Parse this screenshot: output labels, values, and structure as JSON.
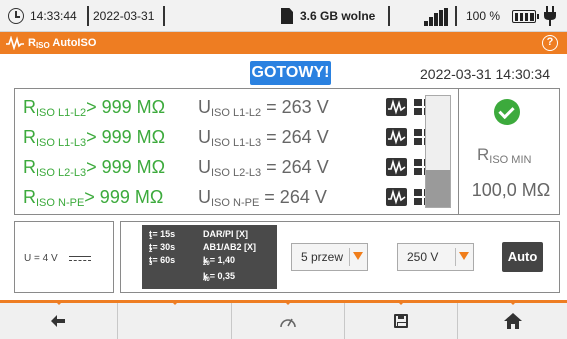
{
  "status_bar": {
    "time": "14:33:44",
    "date": "2022-03-31",
    "storage": "3.6 GB wolne",
    "battery_percent": "100 %",
    "battery_level": 1.0,
    "icons": [
      "clock-icon",
      "sd-card-icon",
      "signal-icon",
      "battery-icon",
      "plug-icon"
    ]
  },
  "title_bar": {
    "title_main": "R",
    "title_sub": "ISO",
    "title_rest": " AutoISO",
    "help_label": "?",
    "icons": [
      "waveform-icon",
      "help-icon"
    ]
  },
  "status": {
    "badge": "GOTOWY!",
    "datetime": "2022-03-31 14:30:34"
  },
  "results": [
    {
      "r_main": "R",
      "r_sub": "ISO L1-L2",
      "r_value": "> 999 MΩ",
      "u_main": "U",
      "u_sub": "ISO L1-L2",
      "u_value": " = 263 V"
    },
    {
      "r_main": "R",
      "r_sub": "ISO L1-L3",
      "r_value": "> 999 MΩ",
      "u_main": "U",
      "u_sub": "ISO L1-L3",
      "u_value": " = 264 V"
    },
    {
      "r_main": "R",
      "r_sub": "ISO L2-L3",
      "r_value": "> 999 MΩ",
      "u_main": "U",
      "u_sub": "ISO L2-L3",
      "u_value": " = 264 V"
    },
    {
      "r_main": "R",
      "r_sub": "ISO N-PE",
      "r_value": "> 999 MΩ",
      "u_main": "U",
      "u_sub": "ISO N-PE",
      "u_value": " = 264 V"
    }
  ],
  "progress_level": 0.33,
  "rmin": {
    "main": "R",
    "sub": "ISO MIN",
    "value": "100,0 MΩ"
  },
  "voltage_indicator": "U = 4 V",
  "params": {
    "t1_label": "t",
    "t1_sub": "1",
    "t1_value": " = 15s",
    "t2_label": "t",
    "t2_sub": "2",
    "t2_value": " = 30s",
    "t3_label": "t",
    "t3_sub": "3",
    "t3_value": " = 60s",
    "dar_pi": "DAR/PI    [X]",
    "ab": "AB1/AB2   [X]",
    "k20_label": "k",
    "k20_sub": "20",
    "k20_value": " = 1,40",
    "k40_label": "k",
    "k40_sub": "40",
    "k40_value": " = 0,35"
  },
  "dropdowns": {
    "wires": "5 przew",
    "voltage": "250 V"
  },
  "auto_label": "Auto",
  "toolbar": {
    "buttons": [
      "back-icon",
      "",
      "gauge-icon",
      "save-icon",
      "home-icon"
    ]
  },
  "colors": {
    "accent_orange": "#ee7d22",
    "ready_blue": "#2a81e0",
    "result_green": "#3caa3c",
    "dark_button": "#444444"
  }
}
